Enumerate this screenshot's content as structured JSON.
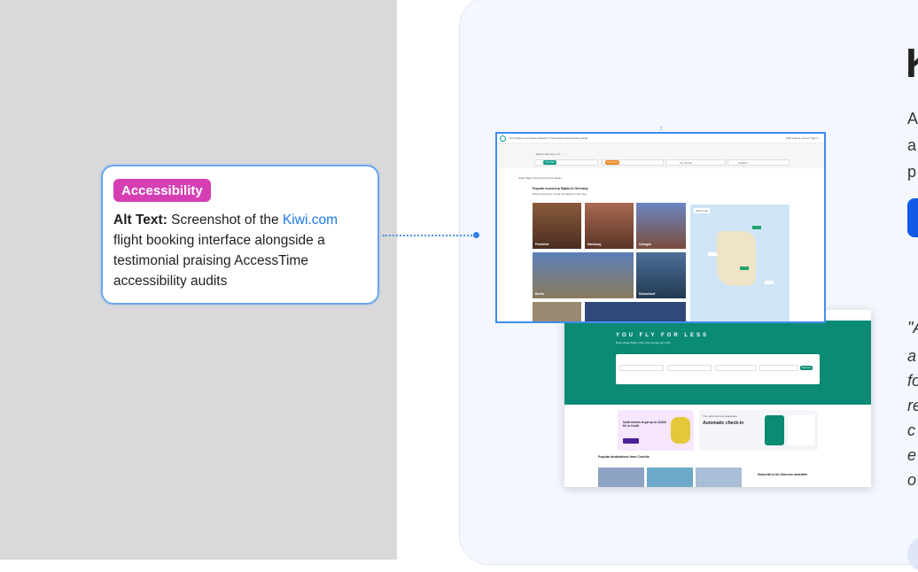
{
  "annotation": {
    "badge": "Accessibility",
    "alt_label": "Alt Text:",
    "alt_before_link": " Screenshot of the ",
    "alt_link": "Kiwi.com",
    "alt_after_link": " flight booking interface alongside a testimonial praising AccessTime accessibility audits"
  },
  "screenshot_top": {
    "nav_links": "Kiwi   Flights   Cars   Stays   Magazine   Travel hacks   Destinations   Deals",
    "nav_right": "USD   Help & support   Sign in",
    "search_opts": "Return   Economy   1   0",
    "from_chip": "Czechia",
    "to_chip": "Germany",
    "departure": "Fri, 26 Oct",
    "return": "Anytime",
    "filters": "Stops   Bags   Times/hours   Price   Dates",
    "section_title": "Popular round-trip flights to Germany",
    "section_sub": "Book and pay for round-trip flights to Germany",
    "tiles": [
      "Frankfurt",
      "Hamburg",
      "Cologne",
      "Berlin",
      "Düsseldorf"
    ],
    "map_label": "Show map"
  },
  "screenshot_bottom": {
    "nav_links": "Flights   Cars   Stays   Magazine   Travel hacks   Destinations   Deals",
    "hero_title": "YOU FLY FOR LESS",
    "hero_sub": "Book cheap flights other sites simply can't find",
    "search_button": "Explore",
    "promo1_title": "Invite friends to get up to 10,000 Kč in Credit",
    "promo2_kicker": "The new Kiwi.com guarantee",
    "promo2_title": "Automatic check-in",
    "popular_title": "Popular destinations from Czechia",
    "newsletter": "Subscribe to the Kiwi.com newsletter"
  },
  "right_panel": {
    "heading": "Ki",
    "para_lines": [
      "A",
      "a",
      "p"
    ],
    "quote_lines": [
      "\"A",
      "a",
      "fo",
      "re",
      "c",
      "e",
      "o"
    ]
  },
  "colors": {
    "badge": "#d63fb4",
    "link": "#1f79e6",
    "kiwi_green": "#0b8a74",
    "selection_blue": "#3f8df0"
  }
}
